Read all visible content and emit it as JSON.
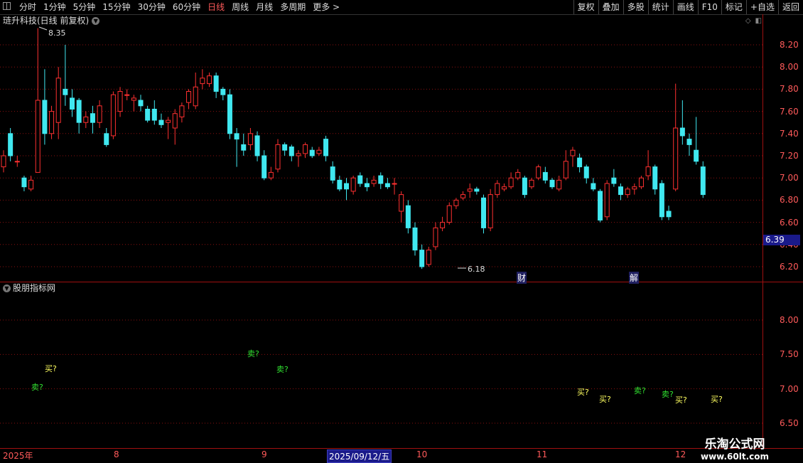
{
  "toolbar": {
    "tabs": [
      {
        "label": "分时",
        "active": false
      },
      {
        "label": "1分钟",
        "active": false
      },
      {
        "label": "5分钟",
        "active": false
      },
      {
        "label": "15分钟",
        "active": false
      },
      {
        "label": "30分钟",
        "active": false
      },
      {
        "label": "60分钟",
        "active": false
      },
      {
        "label": "日线",
        "active": true
      },
      {
        "label": "周线",
        "active": false
      },
      {
        "label": "月线",
        "active": false
      },
      {
        "label": "多周期",
        "active": false
      },
      {
        "label": "更多 >",
        "active": false
      }
    ],
    "right_buttons": [
      "复权",
      "叠加",
      "多股",
      "统计",
      "画线",
      "F10",
      "标记",
      "+自选",
      "返回"
    ]
  },
  "main_chart": {
    "title": "琏升科技(日线 前复权)",
    "high_label": "8.35",
    "low_label": "6.18",
    "current_price": "6.39",
    "y_ticks": [
      "8.20",
      "8.00",
      "7.80",
      "7.60",
      "7.40",
      "7.20",
      "7.00",
      "6.80",
      "6.60",
      "6.40",
      "6.20"
    ],
    "event_tags": [
      "财",
      "解"
    ]
  },
  "sub_chart": {
    "title": "股朋指标网",
    "y_ticks": [
      "8.00",
      "7.50",
      "7.00",
      "6.50"
    ],
    "signals": [
      {
        "text": "卖?",
        "type": "sell"
      },
      {
        "text": "买?",
        "type": "buy"
      },
      {
        "text": "卖?",
        "type": "sell"
      },
      {
        "text": "卖?",
        "type": "sell"
      },
      {
        "text": "买?",
        "type": "buy"
      },
      {
        "text": "买?",
        "type": "buy"
      },
      {
        "text": "卖?",
        "type": "sell"
      },
      {
        "text": "卖?",
        "type": "sell"
      },
      {
        "text": "买?",
        "type": "buy"
      },
      {
        "text": "买?",
        "type": "buy"
      }
    ]
  },
  "x_axis": {
    "labels": [
      "2025年",
      "8",
      "9",
      "2025/09/12/五",
      "10",
      "11",
      "12"
    ]
  },
  "watermark": {
    "line1": "乐淘公式网",
    "line2": "www.60lt.com"
  },
  "colors": {
    "up": "#ff3030",
    "down": "#40e8f0",
    "grid": "#8a1010",
    "axis": "#ff5a5a"
  },
  "chart_data": {
    "type": "candlestick",
    "title": "琏升科技(日线 前复权)",
    "ylim": [
      6.1,
      8.3
    ],
    "candles": [
      [
        7.1,
        7.2,
        7.25,
        7.05
      ],
      [
        7.4,
        7.2,
        7.45,
        7.15
      ],
      [
        7.15,
        7.15,
        7.2,
        7.1
      ],
      [
        7.0,
        6.92,
        7.02,
        6.88
      ],
      [
        6.9,
        6.98,
        7.02,
        6.88
      ],
      [
        7.05,
        7.7,
        8.35,
        7.05
      ],
      [
        7.7,
        7.4,
        7.98,
        7.3
      ],
      [
        7.4,
        7.6,
        7.65,
        7.35
      ],
      [
        7.5,
        7.9,
        8.0,
        7.35
      ],
      [
        7.8,
        7.75,
        8.2,
        7.65
      ],
      [
        7.72,
        7.62,
        7.8,
        7.55
      ],
      [
        7.7,
        7.5,
        7.72,
        7.4
      ],
      [
        7.5,
        7.55,
        7.6,
        7.45
      ],
      [
        7.58,
        7.5,
        7.65,
        7.4
      ],
      [
        7.5,
        7.65,
        7.7,
        7.45
      ],
      [
        7.4,
        7.3,
        7.45,
        7.28
      ],
      [
        7.38,
        7.75,
        7.78,
        7.35
      ],
      [
        7.6,
        7.78,
        7.82,
        7.55
      ],
      [
        7.75,
        7.75,
        7.8,
        7.7
      ],
      [
        7.7,
        7.72,
        7.75,
        7.6
      ],
      [
        7.7,
        7.65,
        7.75,
        7.6
      ],
      [
        7.62,
        7.52,
        7.65,
        7.5
      ],
      [
        7.62,
        7.52,
        7.7,
        7.48
      ],
      [
        7.52,
        7.48,
        7.58,
        7.45
      ],
      [
        7.5,
        7.52,
        7.55,
        7.35
      ],
      [
        7.45,
        7.58,
        7.62,
        7.3
      ],
      [
        7.55,
        7.65,
        7.68,
        7.5
      ],
      [
        7.68,
        7.78,
        7.8,
        7.62
      ],
      [
        7.65,
        7.82,
        7.95,
        7.62
      ],
      [
        7.85,
        7.9,
        7.98,
        7.8
      ],
      [
        7.85,
        7.92,
        7.95,
        7.82
      ],
      [
        7.92,
        7.78,
        7.95,
        7.72
      ],
      [
        7.8,
        7.75,
        7.82,
        7.7
      ],
      [
        7.75,
        7.4,
        7.8,
        7.35
      ],
      [
        7.4,
        7.35,
        7.45,
        7.1
      ],
      [
        7.3,
        7.25,
        7.4,
        7.2
      ],
      [
        7.3,
        7.4,
        7.45,
        7.25
      ],
      [
        7.38,
        7.2,
        7.42,
        7.15
      ],
      [
        7.2,
        7.0,
        7.25,
        6.98
      ],
      [
        7.0,
        7.05,
        7.1,
        6.98
      ],
      [
        7.08,
        7.3,
        7.35,
        7.05
      ],
      [
        7.3,
        7.25,
        7.32,
        7.2
      ],
      [
        7.28,
        7.2,
        7.3,
        7.15
      ],
      [
        7.2,
        7.22,
        7.25,
        7.1
      ],
      [
        7.22,
        7.3,
        7.32,
        7.18
      ],
      [
        7.25,
        7.2,
        7.28,
        7.18
      ],
      [
        7.22,
        7.25,
        7.28,
        7.2
      ],
      [
        7.35,
        7.2,
        7.38,
        7.15
      ],
      [
        7.1,
        6.98,
        7.15,
        6.95
      ],
      [
        6.98,
        6.9,
        7.02,
        6.88
      ],
      [
        6.95,
        6.9,
        7.0,
        6.8
      ],
      [
        6.88,
        7.0,
        7.02,
        6.85
      ],
      [
        7.02,
        6.95,
        7.05,
        6.92
      ],
      [
        6.95,
        6.92,
        7.0,
        6.88
      ],
      [
        6.95,
        6.98,
        7.02,
        6.92
      ],
      [
        7.02,
        6.95,
        7.05,
        6.9
      ],
      [
        6.95,
        6.92,
        7.0,
        6.9
      ],
      [
        6.95,
        6.95,
        7.0,
        6.85
      ],
      [
        6.7,
        6.85,
        6.88,
        6.6
      ],
      [
        6.75,
        6.55,
        6.8,
        6.5
      ],
      [
        6.55,
        6.35,
        6.6,
        6.3
      ],
      [
        6.35,
        6.2,
        6.4,
        6.18
      ],
      [
        6.22,
        6.35,
        6.38,
        6.2
      ],
      [
        6.38,
        6.55,
        6.6,
        6.35
      ],
      [
        6.55,
        6.6,
        6.65,
        6.52
      ],
      [
        6.6,
        6.75,
        6.78,
        6.58
      ],
      [
        6.75,
        6.8,
        6.82,
        6.72
      ],
      [
        6.82,
        6.85,
        6.88,
        6.8
      ],
      [
        6.88,
        6.9,
        6.95,
        6.82
      ],
      [
        6.9,
        6.88,
        6.92,
        6.85
      ],
      [
        6.82,
        6.55,
        6.85,
        6.5
      ],
      [
        6.55,
        6.85,
        6.9,
        6.52
      ],
      [
        6.85,
        6.95,
        6.98,
        6.82
      ],
      [
        6.9,
        6.92,
        6.95,
        6.88
      ],
      [
        6.92,
        7.0,
        7.05,
        6.9
      ],
      [
        7.0,
        7.05,
        7.08,
        6.98
      ],
      [
        7.0,
        6.85,
        7.02,
        6.82
      ],
      [
        6.92,
        6.98,
        7.0,
        6.9
      ],
      [
        7.0,
        7.1,
        7.12,
        6.98
      ],
      [
        7.05,
        6.98,
        7.1,
        6.95
      ],
      [
        6.98,
        6.92,
        7.0,
        6.9
      ],
      [
        6.9,
        6.98,
        7.02,
        6.88
      ],
      [
        7.0,
        7.15,
        7.25,
        6.98
      ],
      [
        7.2,
        7.25,
        7.28,
        7.1
      ],
      [
        7.18,
        7.1,
        7.22,
        7.05
      ],
      [
        7.1,
        7.0,
        7.12,
        6.95
      ],
      [
        6.95,
        6.9,
        7.0,
        6.88
      ],
      [
        6.88,
        6.62,
        6.9,
        6.6
      ],
      [
        6.65,
        6.95,
        6.98,
        6.62
      ],
      [
        7.0,
        6.95,
        7.08,
        6.92
      ],
      [
        6.92,
        6.85,
        6.95,
        6.8
      ],
      [
        6.85,
        6.9,
        6.92,
        6.82
      ],
      [
        6.9,
        6.92,
        6.95,
        6.85
      ],
      [
        6.92,
        7.0,
        7.02,
        6.9
      ],
      [
        7.02,
        7.1,
        7.25,
        6.98
      ],
      [
        7.1,
        6.9,
        7.12,
        6.85
      ],
      [
        6.95,
        6.65,
        6.98,
        6.62
      ],
      [
        6.7,
        6.65,
        6.75,
        6.62
      ],
      [
        6.9,
        7.45,
        7.85,
        6.88
      ],
      [
        7.45,
        7.38,
        7.7,
        7.3
      ],
      [
        7.35,
        7.3,
        7.4,
        7.2
      ],
      [
        7.25,
        7.15,
        7.55,
        7.12
      ],
      [
        7.1,
        6.85,
        7.15,
        6.82
      ]
    ]
  }
}
